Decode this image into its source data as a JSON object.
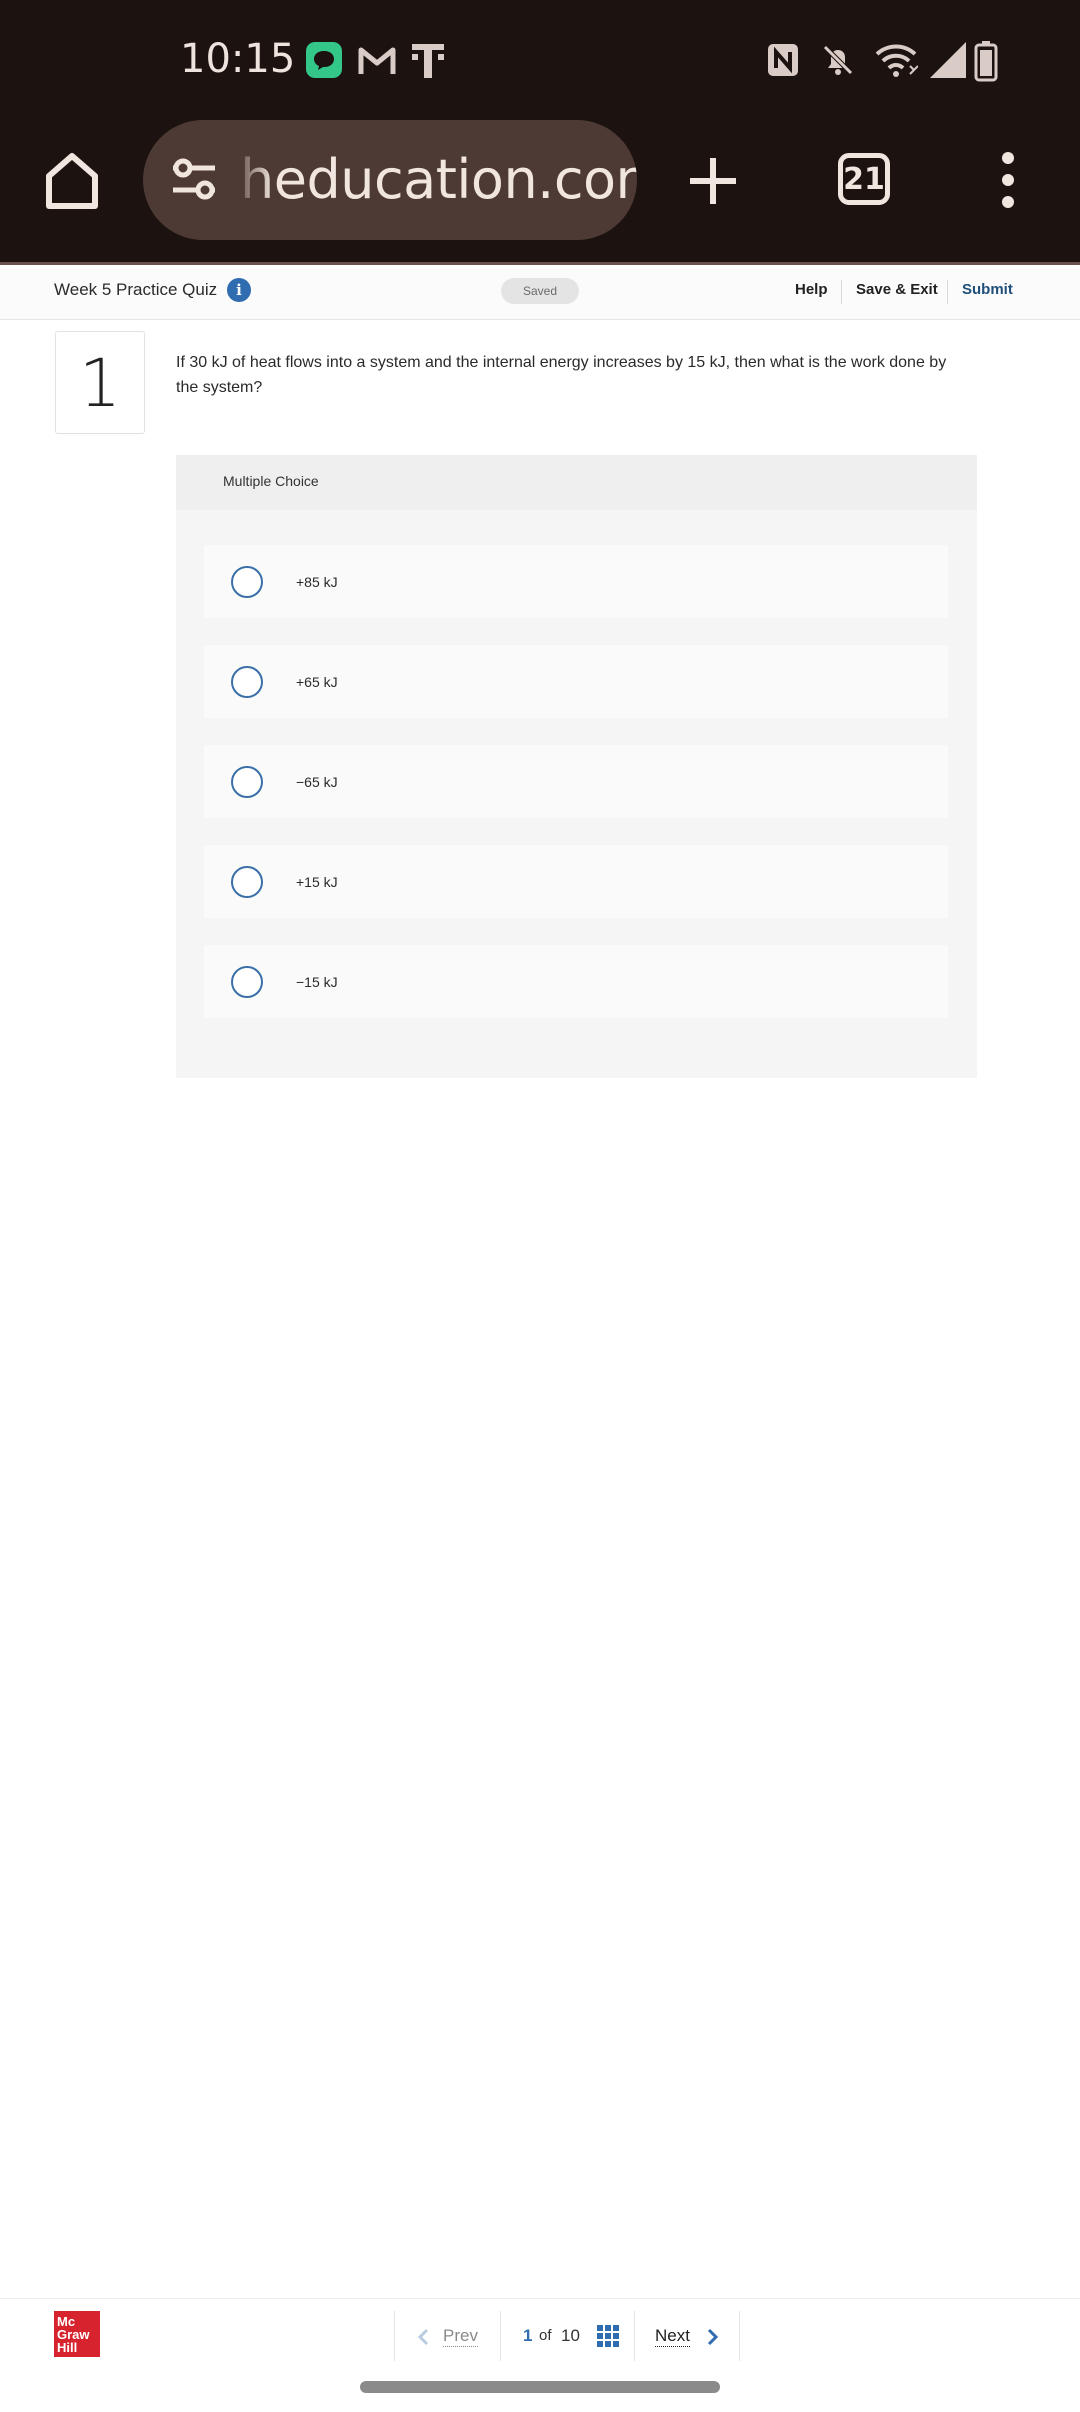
{
  "status_bar": {
    "time": "10:15",
    "left_icons": [
      "messages-app-icon",
      "gmail-icon",
      "tmobile-icon"
    ],
    "right_icons": [
      "nfc-icon",
      "bell-muted-icon",
      "wifi-icon",
      "signal-icon",
      "battery-icon"
    ]
  },
  "browser": {
    "url": "heducation.com",
    "tab_count": "21",
    "icons": [
      "home-icon",
      "site-settings-icon",
      "new-tab-icon",
      "tab-switcher-icon",
      "more-menu-icon"
    ]
  },
  "quiz_header": {
    "title": "Week 5 Practice Quiz",
    "info_glyph": "i",
    "saved_label": "Saved",
    "help_label": "Help",
    "save_exit_label": "Save & Exit",
    "submit_label": "Submit"
  },
  "question": {
    "number": "1",
    "text": "If 30 kJ of heat flows into a system and the internal energy increases by 15 kJ, then what is the work done by the system?",
    "type_label": "Multiple Choice",
    "options": [
      {
        "label": "+85 kJ",
        "selected": false
      },
      {
        "label": "+65 kJ",
        "selected": false
      },
      {
        "label": "−65 kJ",
        "selected": false
      },
      {
        "label": "+15 kJ",
        "selected": false
      },
      {
        "label": "−15 kJ",
        "selected": false
      }
    ]
  },
  "footer": {
    "logo_lines": [
      "Mc",
      "Graw",
      "Hill"
    ],
    "prev_label": "Prev",
    "current_page": "1",
    "of_label": "of",
    "total_pages": "10",
    "next_label": "Next"
  },
  "colors": {
    "system_bar_bg": "#1c1210",
    "url_pill_bg": "#4e3a35",
    "accent_blue": "#2f6db0",
    "submit_color": "#1f4e79",
    "brand_red": "#d6232d"
  }
}
